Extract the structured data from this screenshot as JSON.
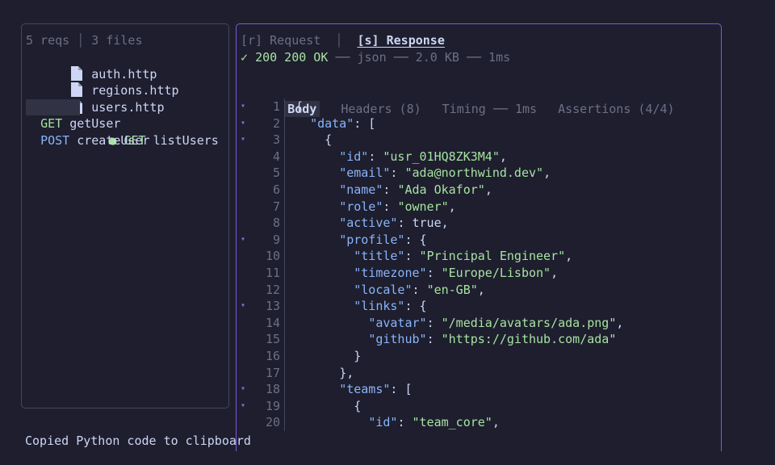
{
  "sidebar": {
    "req_count": "5 reqs",
    "file_count": "3 files",
    "files": [
      "auth.http",
      "regions.http",
      "users.http"
    ],
    "requests": [
      {
        "method": "GET",
        "name": "listUsers",
        "selected": true
      },
      {
        "method": "GET",
        "name": "getUser",
        "selected": false
      },
      {
        "method": "POST",
        "name": "createUser",
        "selected": false
      }
    ]
  },
  "panel": {
    "tab_request": "[r] Request",
    "tab_response": "[s] Response",
    "status_check": "✓",
    "status_code": "200 200 OK",
    "meta": "── json ── 2.0 KB ── 1ms",
    "subtabs": [
      "Body",
      "Headers (8)",
      "Timing ── 1ms",
      "Assertions (4/4)"
    ],
    "active_subtab": "Body"
  },
  "code_lines": [
    {
      "n": "1",
      "fold": true,
      "text": "{"
    },
    {
      "n": "2",
      "fold": true,
      "indent": "  ",
      "key": "\"data\"",
      "rest": ": ["
    },
    {
      "n": "3",
      "fold": true,
      "indent": "    ",
      "text": "{"
    },
    {
      "n": "4",
      "fold": false,
      "indent": "      ",
      "key": "\"id\"",
      "sep": ": ",
      "val": "\"usr_01HQ8ZK3M4\"",
      "tail": ","
    },
    {
      "n": "5",
      "fold": false,
      "indent": "      ",
      "key": "\"email\"",
      "sep": ": ",
      "val": "\"ada@northwind.dev\"",
      "tail": ","
    },
    {
      "n": "6",
      "fold": false,
      "indent": "      ",
      "key": "\"name\"",
      "sep": ": ",
      "val": "\"Ada Okafor\"",
      "tail": ","
    },
    {
      "n": "7",
      "fold": false,
      "indent": "      ",
      "key": "\"role\"",
      "sep": ": ",
      "val": "\"owner\"",
      "tail": ","
    },
    {
      "n": "8",
      "fold": false,
      "indent": "      ",
      "key": "\"active\"",
      "rest": ": true,"
    },
    {
      "n": "9",
      "fold": true,
      "indent": "      ",
      "key": "\"profile\"",
      "rest": ": {"
    },
    {
      "n": "10",
      "fold": false,
      "indent": "        ",
      "key": "\"title\"",
      "sep": ": ",
      "val": "\"Principal Engineer\"",
      "tail": ","
    },
    {
      "n": "11",
      "fold": false,
      "indent": "        ",
      "key": "\"timezone\"",
      "sep": ": ",
      "val": "\"Europe/Lisbon\"",
      "tail": ","
    },
    {
      "n": "12",
      "fold": false,
      "indent": "        ",
      "key": "\"locale\"",
      "sep": ": ",
      "val": "\"en-GB\"",
      "tail": ","
    },
    {
      "n": "13",
      "fold": true,
      "indent": "        ",
      "key": "\"links\"",
      "rest": ": {"
    },
    {
      "n": "14",
      "fold": false,
      "indent": "          ",
      "key": "\"avatar\"",
      "sep": ": ",
      "val": "\"/media/avatars/ada.png\"",
      "tail": ","
    },
    {
      "n": "15",
      "fold": false,
      "indent": "          ",
      "key": "\"github\"",
      "sep": ": ",
      "val": "\"https://github.com/ada\"",
      "tail": ""
    },
    {
      "n": "16",
      "fold": false,
      "indent": "        ",
      "text": "}"
    },
    {
      "n": "17",
      "fold": false,
      "indent": "      ",
      "text": "},"
    },
    {
      "n": "18",
      "fold": true,
      "indent": "      ",
      "key": "\"teams\"",
      "rest": ": ["
    },
    {
      "n": "19",
      "fold": true,
      "indent": "        ",
      "text": "{"
    },
    {
      "n": "20",
      "fold": false,
      "indent": "          ",
      "key": "\"id\"",
      "sep": ": ",
      "val": "\"team_core\"",
      "tail": ","
    }
  ],
  "status_message": "Copied Python code to clipboard",
  "colors": {
    "background": "#1e1e2e",
    "accent_border": "#7f5bd6",
    "key": "#89b4fa",
    "string": "#a6e3a1",
    "muted": "#6c7086"
  },
  "icons": {
    "file": "file-icon",
    "fold_marker": "▾",
    "status_dot": "●"
  }
}
